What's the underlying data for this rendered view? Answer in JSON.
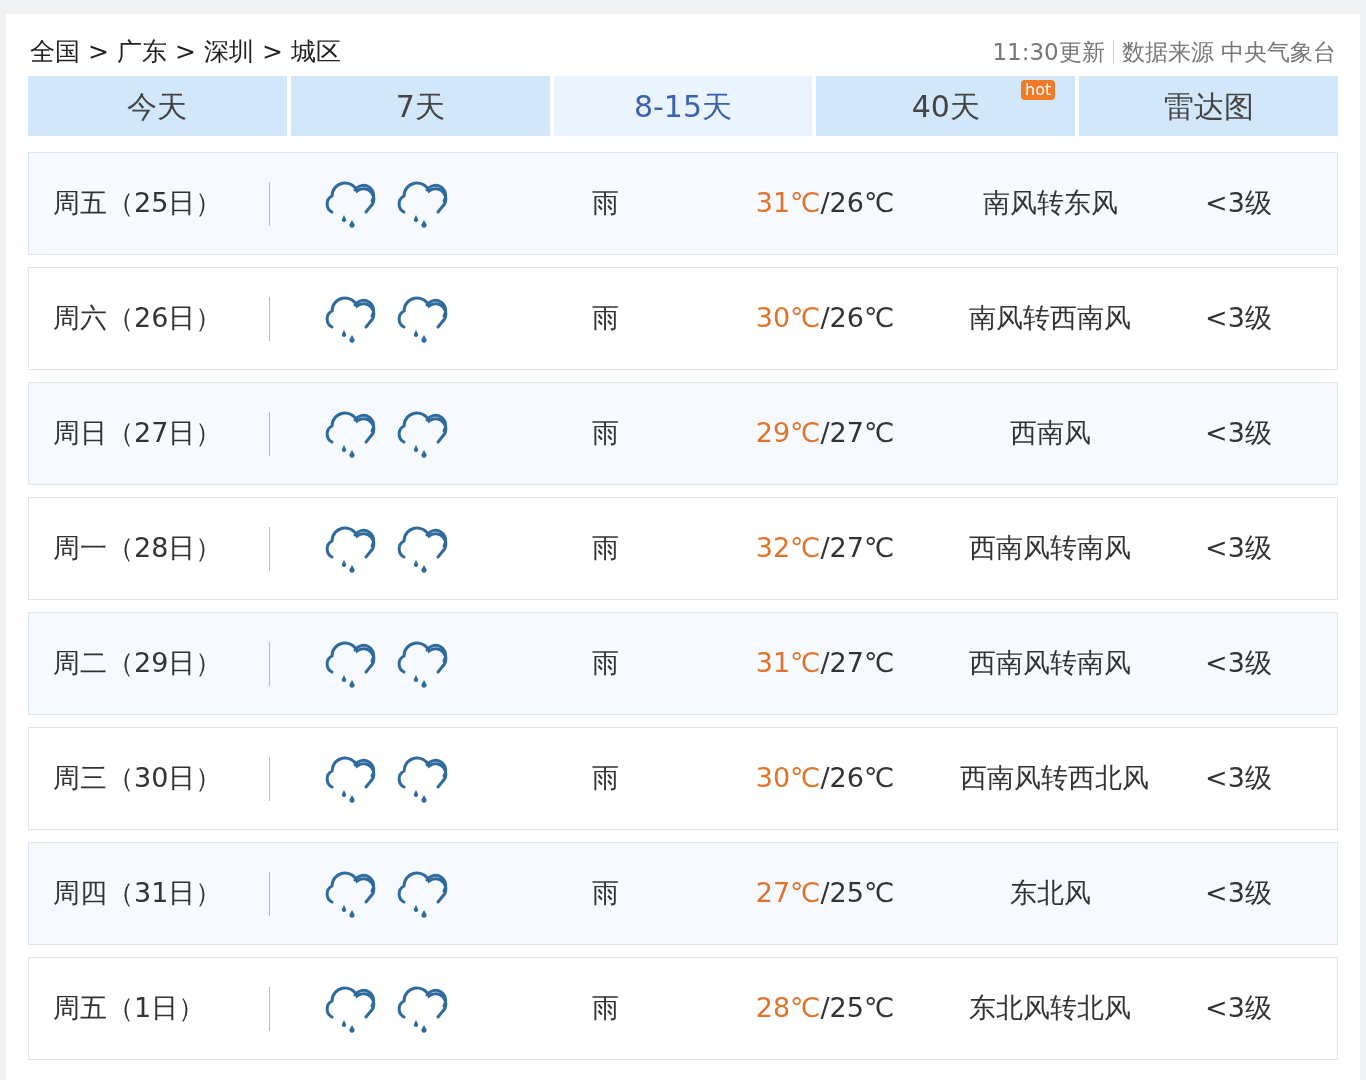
{
  "breadcrumb": [
    "全国",
    "广东",
    "深圳",
    "城区"
  ],
  "breadcrumb_separator": ">",
  "update_time": "11:30更新",
  "source": "数据来源 中央气象台",
  "tabs": [
    {
      "label": "今天",
      "selected": false
    },
    {
      "label": "7天",
      "selected": false
    },
    {
      "label": "8-15天",
      "selected": true
    },
    {
      "label": "40天",
      "selected": false,
      "badge": "hot"
    },
    {
      "label": "雷达图",
      "selected": false
    }
  ],
  "days": [
    {
      "date": "周五（25日）",
      "weather": "雨",
      "high": "31℃",
      "low": "/26℃",
      "wind": "南风转东风",
      "level": "<3级"
    },
    {
      "date": "周六（26日）",
      "weather": "雨",
      "high": "30℃",
      "low": "/26℃",
      "wind": "南风转西南风",
      "level": "<3级"
    },
    {
      "date": "周日（27日）",
      "weather": "雨",
      "high": "29℃",
      "low": "/27℃",
      "wind": "西南风",
      "level": "<3级"
    },
    {
      "date": "周一（28日）",
      "weather": "雨",
      "high": "32℃",
      "low": "/27℃",
      "wind": "西南风转南风",
      "level": "<3级"
    },
    {
      "date": "周二（29日）",
      "weather": "雨",
      "high": "31℃",
      "low": "/27℃",
      "wind": "西南风转南风",
      "level": "<3级"
    },
    {
      "date": "周三（30日）",
      "weather": "雨",
      "high": "30℃",
      "low": "/26℃",
      "wind": "西南风转西北风",
      "level": "<3级"
    },
    {
      "date": "周四（31日）",
      "weather": "雨",
      "high": "27℃",
      "low": "/25℃",
      "wind": "东北风",
      "level": "<3级"
    },
    {
      "date": "周五（1日）",
      "weather": "雨",
      "high": "28℃",
      "low": "/25℃",
      "wind": "东北风转北风",
      "level": "<3级"
    }
  ]
}
